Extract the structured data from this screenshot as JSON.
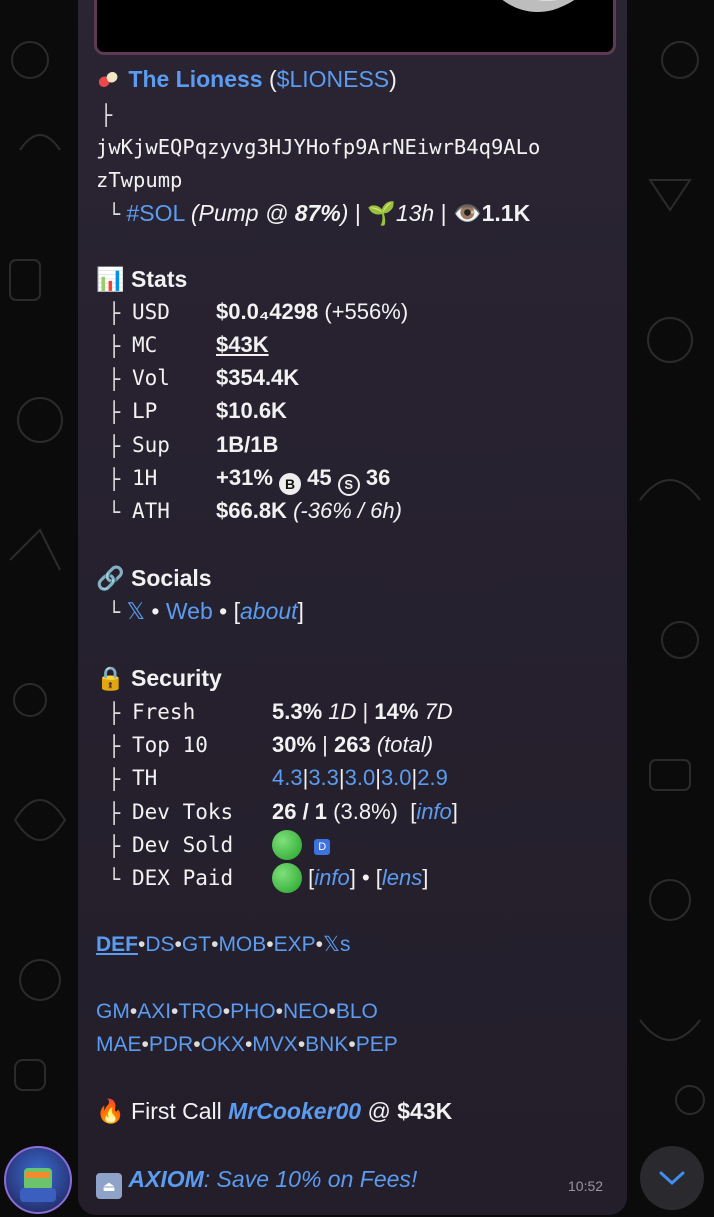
{
  "token": {
    "icon": "pill-emoji",
    "name": "The Lioness",
    "ticker": "$LIONESS",
    "address_line1": "jwKjwEQPqzyvg3HJYHofp9ArNEiwrB4q9ALo",
    "address_line2": "zTwpump",
    "chain_tag": "#SOL",
    "pump_text_pre": "(Pump @ ",
    "pump_pct": "87%",
    "pump_text_post": ")",
    "age": "13h",
    "views": "1.1K"
  },
  "stats": {
    "title": "Stats",
    "rows": [
      {
        "label": "USD",
        "value": "$0.0₄4298",
        "extra": "(+556%)"
      },
      {
        "label": "MC",
        "value": "$43K",
        "extra": ""
      },
      {
        "label": "Vol",
        "value": "$354.4K",
        "extra": ""
      },
      {
        "label": "LP",
        "value": "$10.6K",
        "extra": ""
      },
      {
        "label": "Sup",
        "value": "1B/1B",
        "extra": ""
      },
      {
        "label": "1H",
        "value": "+31%",
        "buy_label": "B",
        "buy": "45",
        "sell_label": "S",
        "sell": "36"
      },
      {
        "label": "ATH",
        "value": "$66.8K",
        "extra": "(-36% / 6h)"
      }
    ]
  },
  "socials": {
    "title": "Socials",
    "x_link": "𝕏",
    "web": "Web",
    "about": "about"
  },
  "security": {
    "title": "Security",
    "fresh": {
      "label": "Fresh",
      "v1": "5.3%",
      "p1": "1D",
      "v2": "14%",
      "p2": "7D"
    },
    "top10": {
      "label": "Top 10",
      "v1": "30%",
      "v2": "263",
      "p2": "(total)"
    },
    "th": {
      "label": "TH",
      "values": [
        "4.3",
        "3.3",
        "3.0",
        "3.0",
        "2.9"
      ]
    },
    "devtoks": {
      "label": "Dev Toks",
      "v1": "26 / 1",
      "p1": "(3.8%)",
      "link": "info"
    },
    "devsold": {
      "label": "Dev Sold",
      "badge": "D"
    },
    "dexpaid": {
      "label": "DEX Paid",
      "link1": "info",
      "link2": "lens"
    }
  },
  "links_row1": [
    "DEF",
    "DS",
    "GT",
    "MOB",
    "EXP",
    "𝕏s"
  ],
  "links_row2": [
    "GM",
    "AXI",
    "TRO",
    "PHO",
    "NEO",
    "BLO"
  ],
  "links_row3": [
    "MAE",
    "PDR",
    "OKX",
    "MVX",
    "BNK",
    "PEP"
  ],
  "first_call": {
    "text": "First Call",
    "user": "MrCooker00",
    "at": "@",
    "mc": "$43K"
  },
  "promo": {
    "brand": "AXIOM",
    "text": ": Save 10% on Fees!"
  },
  "message_time": "10:52",
  "colors": {
    "accent_link": "#5b9cf0",
    "green_dot": "#2fb52f",
    "bubble": "#2a2433"
  }
}
